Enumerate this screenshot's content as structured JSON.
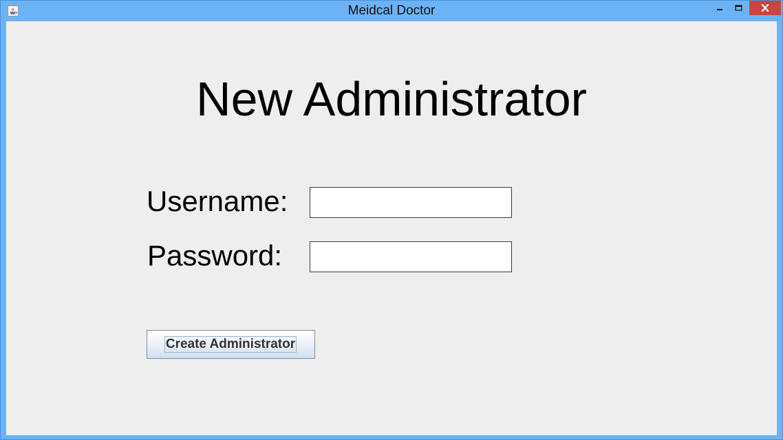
{
  "window": {
    "title": "Meidcal Doctor",
    "accent_color": "#6cb3f5",
    "close_color": "#c7463f",
    "icons": {
      "app": "java-cup-icon",
      "minimize": "minimize-icon",
      "maximize": "maximize-icon",
      "close": "close-icon"
    }
  },
  "form": {
    "heading": "New Administrator",
    "username_label": "Username:",
    "username_value": "",
    "password_label": "Password:",
    "password_value": "",
    "submit_label": "Create Administrator"
  }
}
